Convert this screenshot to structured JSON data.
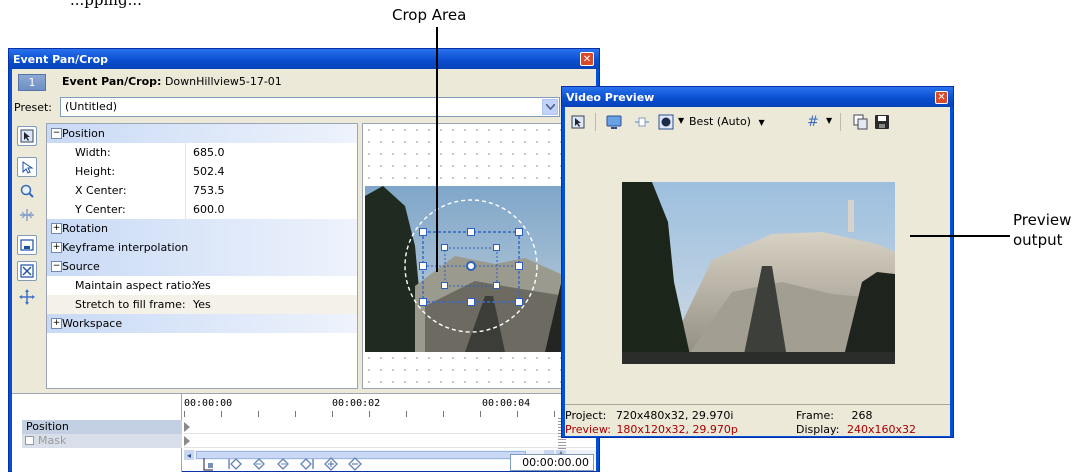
{
  "annotations": {
    "top_cut_text": "...pping...",
    "crop_area": "Crop Area",
    "preview_output_line1": "Preview",
    "preview_output_line2": "output"
  },
  "pan_crop": {
    "title": "Event Pan/Crop",
    "close_icon": "close-icon",
    "event_number": "1",
    "event_label": "Event Pan/Crop:",
    "event_name": "DownHillview5-17-01",
    "preset_label": "Preset:",
    "preset_value": "(Untitled)",
    "tools": [
      "normal-edit-icon",
      "select-icon",
      "zoom-icon",
      "lock-aspect-icon",
      "size-about-center-icon",
      "move-freely-icon",
      "move-icon"
    ],
    "properties": {
      "position_label": "Position",
      "width_label": "Width:",
      "width_value": "685.0",
      "height_label": "Height:",
      "height_value": "502.4",
      "xcenter_label": "X Center:",
      "xcenter_value": "753.5",
      "ycenter_label": "Y Center:",
      "ycenter_value": "600.0",
      "rotation_label": "Rotation",
      "keyframe_label": "Keyframe interpolation",
      "source_label": "Source",
      "aspect_label": "Maintain aspect ratio:",
      "aspect_value": "Yes",
      "stretch_label": "Stretch to fill frame:",
      "stretch_value": "Yes",
      "workspace_label": "Workspace"
    },
    "timeline": {
      "tracks": [
        "Position",
        "Mask"
      ],
      "ticks": [
        "00:00:00",
        "00:00:02",
        "00:00:04"
      ],
      "time_display": "00:00:00.00"
    }
  },
  "video_preview": {
    "title": "Video Preview",
    "quality": "Best (Auto)",
    "toolbar_icons": [
      "preview-settings-icon",
      "external-monitor-icon",
      "split-screen-icon",
      "overlay-icon",
      "grid-icon",
      "copy-snapshot-icon",
      "save-snapshot-icon"
    ],
    "project_label": "Project:",
    "project_value": "720x480x32, 29.970i",
    "preview_label": "Preview:",
    "preview_value": "180x120x32, 29.970p",
    "frame_label": "Frame:",
    "frame_value": "268",
    "display_label": "Display:",
    "display_value": "240x160x32"
  },
  "colors": {
    "title_blue": "#0a4fd0",
    "dialog_face": "#ece9d8",
    "status_red": "#a80000"
  }
}
